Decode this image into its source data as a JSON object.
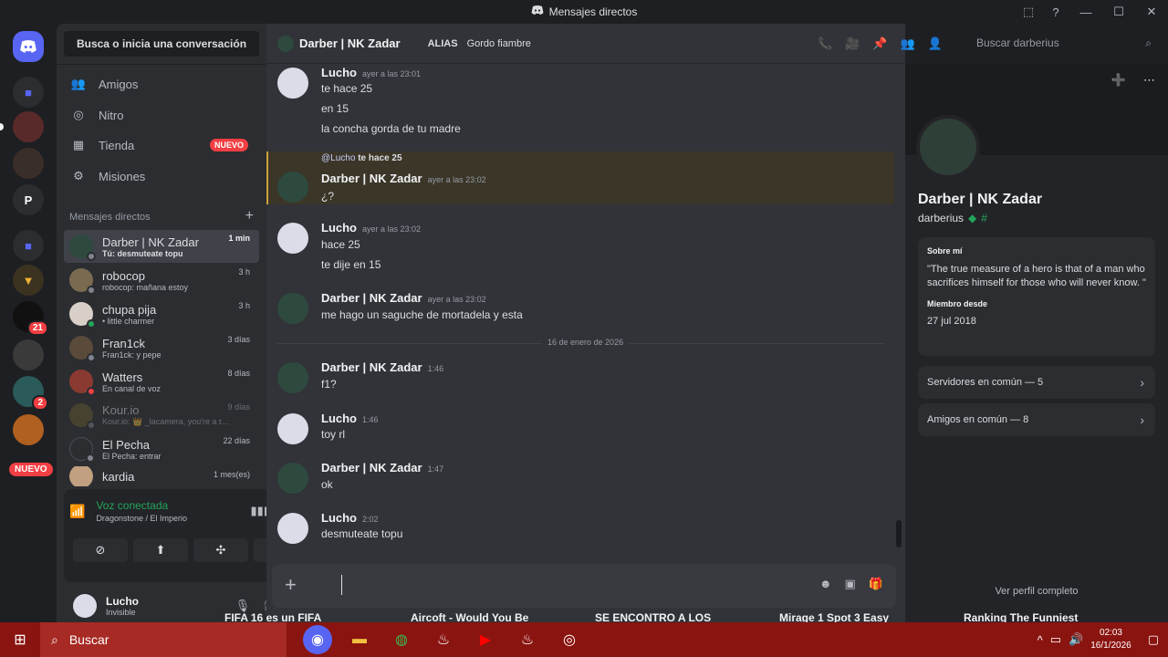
{
  "window": {
    "title": "Mensajes directos"
  },
  "sidebar": {
    "search_label": "Busca o inicia una conversación",
    "nav": [
      {
        "label": "Amigos",
        "icon": "friends-icon"
      },
      {
        "label": "Nitro",
        "icon": "nitro-icon"
      },
      {
        "label": "Tienda",
        "icon": "shop-icon",
        "tag": "NUEVO"
      },
      {
        "label": "Misiones",
        "icon": "quests-icon"
      }
    ],
    "dm_header": "Mensajes directos",
    "dms": [
      {
        "name": "Darber | NK Zadar",
        "sub": "Tú: desmuteate topu",
        "time": "1 min"
      },
      {
        "name": "robocop",
        "sub": "robocop: mañana estoy",
        "time": "3 h"
      },
      {
        "name": "chupa pija",
        "sub": "• little charmer",
        "time": "3 h"
      },
      {
        "name": "Fran1ck",
        "sub": "Fran1ck: y pepe",
        "time": "3 días"
      },
      {
        "name": "Watters",
        "sub": "En canal de voz",
        "time": "8 días"
      },
      {
        "name": "Kour.io",
        "sub": "Kour.io: 👑 _lacamera, you're a tr...",
        "time": "9 días"
      },
      {
        "name": "El Pecha",
        "sub": "El Pecha: entrar",
        "time": "22 días"
      },
      {
        "name": "kardia",
        "sub": "",
        "time": "1 mes(es)"
      }
    ],
    "voice": {
      "status": "Voz conectada",
      "channel": "Dragonstone / El Imperio"
    },
    "user": {
      "name": "Lucho",
      "status": "Invisible"
    }
  },
  "rail": {
    "letter": "P",
    "badges": [
      "21",
      "2"
    ],
    "new_label": "NUEVO"
  },
  "chat": {
    "header": {
      "name": "Darber | NK Zadar",
      "alias_label": "ALIAS",
      "alias_value": "Gordo fiambre"
    },
    "search_placeholder": "Buscar darberius",
    "reply": {
      "mention": "@Lucho",
      "text": "te hace 25"
    },
    "messages": [
      {
        "author": "Lucho",
        "time": "ayer a las 23:01",
        "lines": [
          "te hace 25",
          "en 15",
          "la concha gorda de tu madre"
        ]
      },
      {
        "author": "Darber | NK Zadar",
        "time": "ayer a las 23:02",
        "lines": [
          "¿?"
        ]
      },
      {
        "author": "Lucho",
        "time": "ayer a las 23:02",
        "lines": [
          "hace 25",
          "te dije en 15"
        ]
      },
      {
        "author": "Darber | NK Zadar",
        "time": "ayer a las 23:02",
        "lines": [
          "me hago un saguche de mortadela y esta"
        ]
      },
      {
        "author": "Darber | NK Zadar",
        "time": "1:46",
        "lines": [
          "f1?"
        ]
      },
      {
        "author": "Lucho",
        "time": "1:46",
        "lines": [
          "toy rl"
        ]
      },
      {
        "author": "Darber | NK Zadar",
        "time": "1:47",
        "lines": [
          "ok"
        ]
      },
      {
        "author": "Lucho",
        "time": "2:02",
        "lines": [
          "desmuteate topu"
        ]
      }
    ],
    "date_divider": "16 de enero de 2026"
  },
  "profile": {
    "name": "Darber | NK Zadar",
    "username": "darberius",
    "about_label": "Sobre mí",
    "about_text": "\"The true measure of a hero is that of a man who sacrifices himself for those who will never know. \"",
    "member_label": "Miembro desde",
    "member_date": "27 jul 2018",
    "servers": "Servidores en común — 5",
    "friends": "Amigos en común — 8",
    "full_profile": "Ver perfil completo"
  },
  "ticker": [
    "FIFA 16 es un FIFA",
    "Aircoft - Would You Be",
    "SE ENCONTRO A LOS",
    "Mirage 1 Spot 3 Easy",
    "Ranking The Funniest"
  ],
  "taskbar": {
    "search_label": "Buscar",
    "time": "02:03",
    "date": "16/1/2026"
  },
  "colors": {
    "accent": "#5865f2",
    "online": "#23a55a",
    "danger": "#f23f43",
    "taskbar": "#8a1410"
  }
}
